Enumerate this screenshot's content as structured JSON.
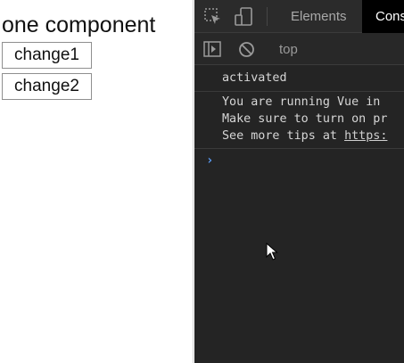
{
  "app": {
    "title": "one component",
    "buttons": [
      "change1",
      "change2"
    ]
  },
  "devtools": {
    "tabs": {
      "elements": "Elements",
      "console": "Cons"
    },
    "context": "top",
    "console_lines": {
      "activated": "activated",
      "vue_1": "You are running Vue in",
      "vue_2": "Make sure to turn on pr",
      "vue_3_prefix": "See more tips at ",
      "vue_3_link": "https:"
    },
    "prompt": "›"
  },
  "icons": [
    "inspect-element-icon",
    "device-toggle-icon",
    "sidebar-toggle-icon",
    "clear-console-icon",
    "prompt-chevron-icon",
    "mouse-cursor-icon"
  ],
  "colors": {
    "devtools_bg": "#242424",
    "active_tab_bg": "#000000",
    "prompt_blue": "#5a9bf5"
  }
}
